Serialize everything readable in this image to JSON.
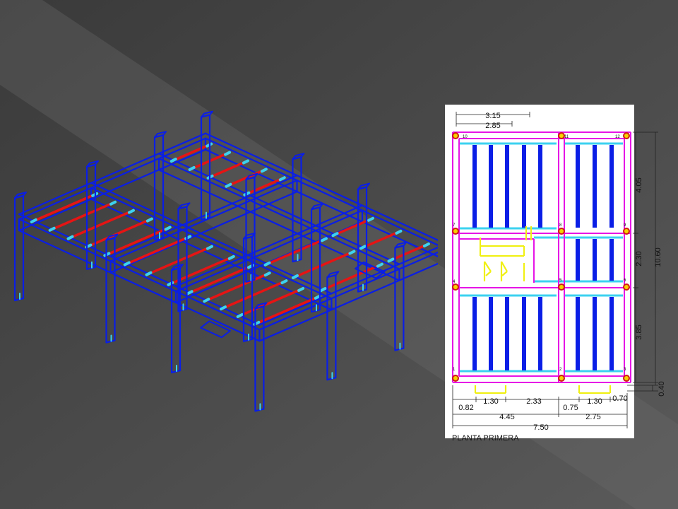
{
  "plan": {
    "title": "PLANTA PRIMERA",
    "top_dims": [
      "3.15",
      "2.85"
    ],
    "bottom_dims_row1": [
      "0.82",
      "1.30",
      "2.33",
      "0.75",
      "1.30",
      "0.70"
    ],
    "bottom_dims_row2": [
      "4.45",
      "2.75"
    ],
    "bottom_total": "7.50",
    "right_dims": [
      "4.05",
      "2.30",
      "3.85"
    ],
    "right_total": "10.60",
    "right_extra": "0.40",
    "node_labels": [
      "10",
      "11",
      "12",
      "7",
      "8",
      "9",
      "4",
      "5",
      "6",
      "1",
      "2",
      "3"
    ]
  },
  "colors": {
    "background": "#4a4a4a",
    "frame": "#0a1ee6",
    "joist": "#e61414",
    "beam": "#e614e6",
    "cyan": "#3cd2f0",
    "stair": "#f0f014",
    "node": "#f5d400",
    "plan_bg": "#ffffff"
  }
}
